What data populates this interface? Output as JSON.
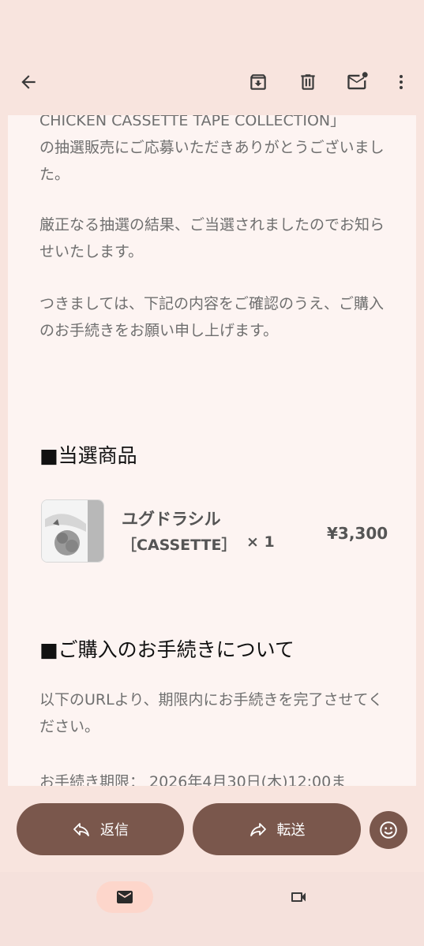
{
  "toolbar": {
    "back_icon": "arrow-left-icon",
    "archive_icon": "archive-icon",
    "delete_icon": "trash-icon",
    "mark_unread_icon": "mail-unread-icon",
    "more_icon": "more-vertical-icon"
  },
  "email": {
    "clipped_top_line": "CHICKEN CASSETTE TAPE COLLECTION」",
    "paragraphs": [
      "の抽選販売にご応募いただきありがとうございました。",
      "厳正なる抽選の結果、ご当選されましたのでお知らせいたします。",
      "つきましては、下記の内容をご確認のうえ、ご購入のお手続きをお願い申し上げます。"
    ],
    "winning_heading": "■当選商品",
    "product": {
      "name": "ユグドラシル",
      "variant": "［CASSETTE］",
      "quantity": "× 1",
      "price": "¥3,300"
    },
    "procedure_heading": "■ご購入のお手続きについて",
    "procedure_text": "以下のURLより、期限内にお手続きを完了させてください。",
    "deadline_line": "お手続き期限： 2026年4月30日(木)12:00ま"
  },
  "actions": {
    "reply_label": "返信",
    "forward_label": "転送",
    "reply_icon": "reply-icon",
    "forward_icon": "forward-icon",
    "emoji_icon": "emoji-icon"
  },
  "bottom_nav": {
    "mail_icon": "mail-icon",
    "video_icon": "video-icon"
  },
  "colors": {
    "background": "#f8e4de",
    "content_background": "#fdf4f2",
    "button_brown": "#7a574c",
    "nav_active_pill": "#fdd6cb"
  }
}
